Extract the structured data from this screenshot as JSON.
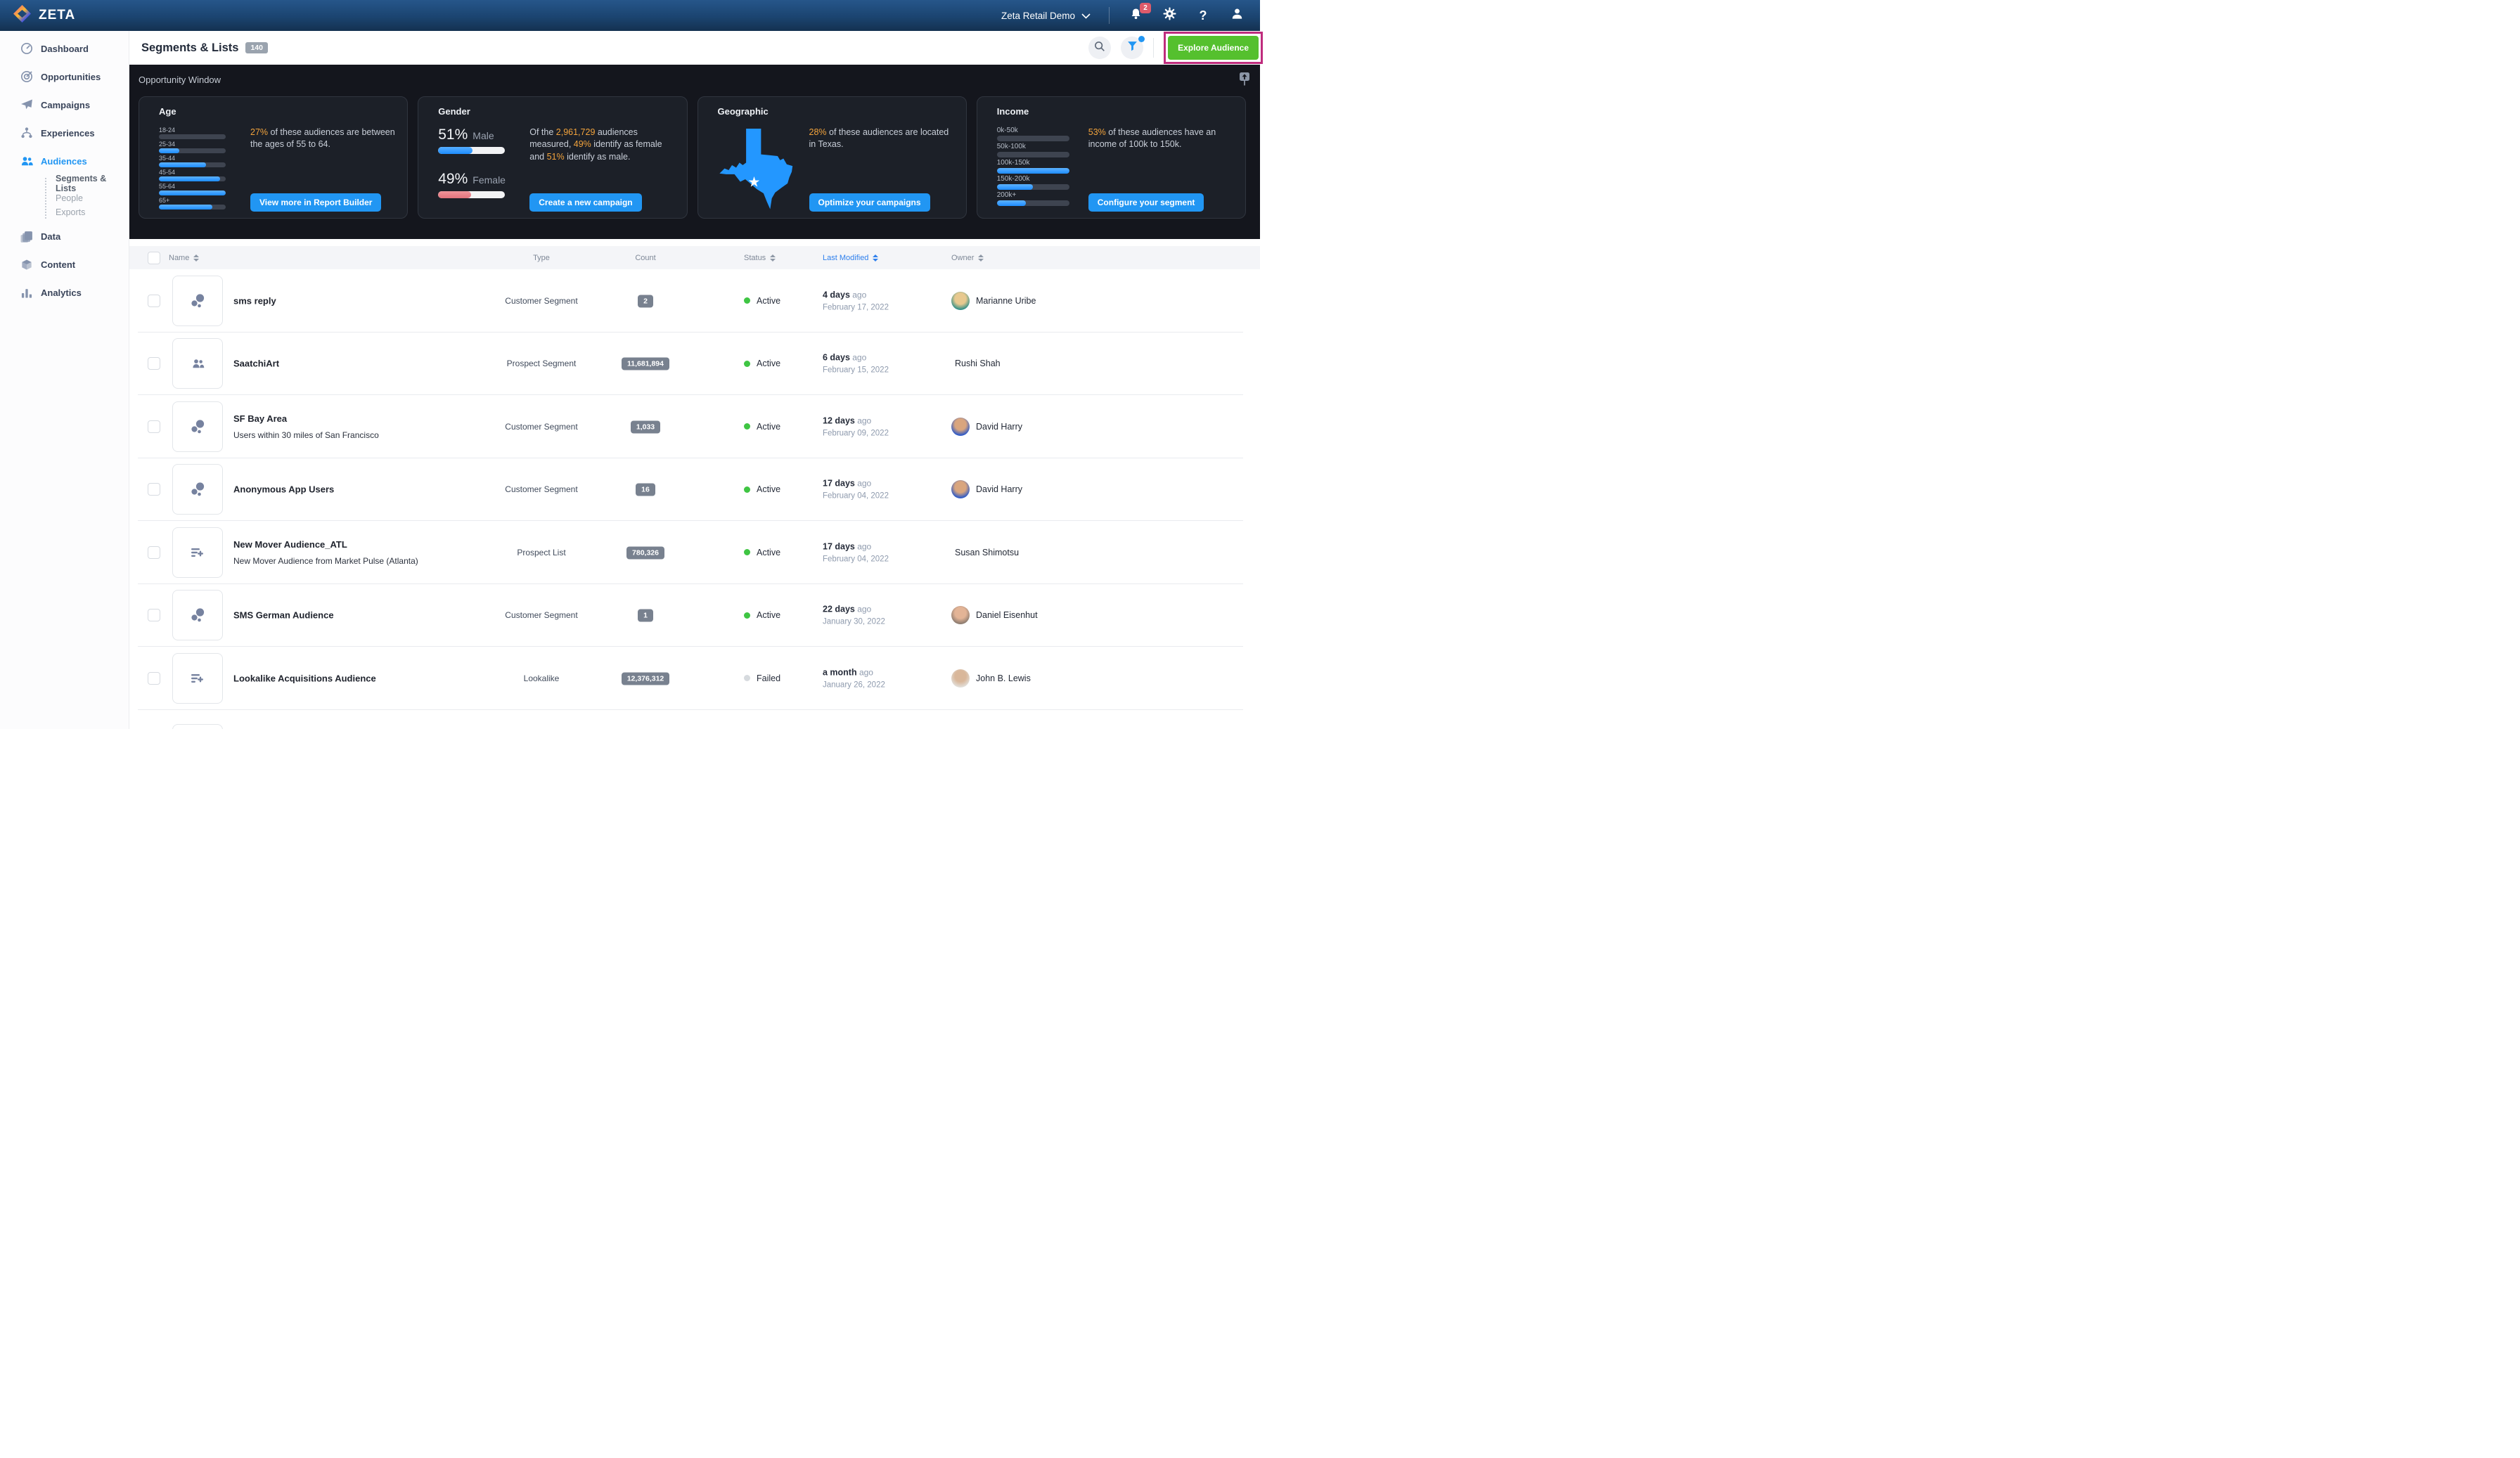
{
  "colors": {
    "accent_blue": "#2196f3",
    "orange": "#f2a33c",
    "green_button": "#55c02e",
    "annotation_magenta": "#bf2c7d",
    "status_active": "#3fc543",
    "status_failed": "#d6dade"
  },
  "topbar": {
    "brand": "ZETA",
    "account": "Zeta Retail Demo",
    "notification_count": "2"
  },
  "sidebar": {
    "items": [
      {
        "label": "Dashboard",
        "icon": "gauge"
      },
      {
        "label": "Opportunities",
        "icon": "target"
      },
      {
        "label": "Campaigns",
        "icon": "paper-plane"
      },
      {
        "label": "Experiences",
        "icon": "flow"
      },
      {
        "label": "Audiences",
        "icon": "people",
        "active": true,
        "has_subs": true
      },
      {
        "label": "Data",
        "icon": "stack"
      },
      {
        "label": "Content",
        "icon": "cube"
      },
      {
        "label": "Analytics",
        "icon": "bars"
      }
    ],
    "subs": [
      {
        "label": "Segments & Lists",
        "active": true
      },
      {
        "label": "People"
      },
      {
        "label": "Exports"
      }
    ]
  },
  "header": {
    "title": "Segments & Lists",
    "count_badge": "140",
    "explore_button": "Explore Audience"
  },
  "opportunity": {
    "section_title": "Opportunity Window",
    "age": {
      "title": "Age",
      "bars": [
        {
          "label": "18-24",
          "pct": 0
        },
        {
          "label": "25-34",
          "pct": 30
        },
        {
          "label": "35-44",
          "pct": 71
        },
        {
          "label": "45-54",
          "pct": 92
        },
        {
          "label": "55-64",
          "pct": 100
        },
        {
          "label": "65+",
          "pct": 80
        }
      ],
      "text": [
        [
          "27%",
          1
        ],
        [
          " of these audiences are between the ages of 55 to 64.",
          0
        ]
      ],
      "button": "View more in Report Builder"
    },
    "gender": {
      "title": "Gender",
      "male_pct": "51%",
      "male_label": "Male",
      "male_fill": 51,
      "female_pct": "49%",
      "female_label": "Female",
      "female_fill": 49,
      "text": [
        [
          "Of the ",
          0
        ],
        [
          "2,961,729",
          1
        ],
        [
          " audiences measured, ",
          0
        ],
        [
          "49%",
          1
        ],
        [
          " identify as female and ",
          0
        ],
        [
          "51%",
          1
        ],
        [
          " identify as male.",
          0
        ]
      ],
      "button": "Create a new campaign"
    },
    "geographic": {
      "title": "Geographic",
      "state": "Texas",
      "text": [
        [
          "28%",
          1
        ],
        [
          " of these audiences are located in Texas.",
          0
        ]
      ],
      "button": "Optimize your campaigns"
    },
    "income": {
      "title": "Income",
      "bars": [
        {
          "label": "0k-50k",
          "pct": 0
        },
        {
          "label": "50k-100k",
          "pct": 0
        },
        {
          "label": "100k-150k",
          "pct": 100
        },
        {
          "label": "150k-200k",
          "pct": 50
        },
        {
          "label": "200k+",
          "pct": 40
        }
      ],
      "text": [
        [
          "53%",
          1
        ],
        [
          " of these audiences have an income of 100k to 150k.",
          0
        ]
      ],
      "button": "Configure your segment"
    }
  },
  "table": {
    "columns": [
      {
        "label": "Name",
        "sortable": true
      },
      {
        "label": "Type"
      },
      {
        "label": "Count"
      },
      {
        "label": "Status",
        "sortable": true
      },
      {
        "label": "Last Modified",
        "sortable": true,
        "sorted": true
      },
      {
        "label": "Owner",
        "sortable": true
      }
    ],
    "rows": [
      {
        "name": "sms reply",
        "icon": "segment",
        "type": "Customer Segment",
        "count": "2",
        "status": "Active",
        "active": true,
        "rel": "4 days",
        "ago": "ago",
        "date": "February 17, 2022",
        "owner": "Marianne Uribe",
        "avatar": {
          "c1": "#e8c98f",
          "c2": "#2f8f88"
        }
      },
      {
        "name": "SaatchiArt",
        "icon": "people",
        "type": "Prospect Segment",
        "count": "11,681,894",
        "status": "Active",
        "active": true,
        "rel": "6 days",
        "ago": "ago",
        "date": "February 15, 2022",
        "owner": "Rushi Shah",
        "avatar": null
      },
      {
        "name": "SF Bay Area",
        "desc": "Users within 30 miles of San Francisco",
        "icon": "segment",
        "type": "Customer Segment",
        "count": "1,033",
        "status": "Active",
        "active": true,
        "rel": "12 days",
        "ago": "ago",
        "date": "February 09, 2022",
        "owner": "David Harry",
        "avatar": {
          "c1": "#d9a57e",
          "c2": "#2857c9"
        }
      },
      {
        "name": "Anonymous App Users",
        "icon": "segment",
        "type": "Customer Segment",
        "count": "16",
        "status": "Active",
        "active": true,
        "rel": "17 days",
        "ago": "ago",
        "date": "February 04, 2022",
        "owner": "David Harry",
        "avatar": {
          "c1": "#d9a57e",
          "c2": "#2857c9"
        }
      },
      {
        "name": "New Mover Audience_ATL",
        "desc": "New Mover Audience from Market Pulse (Atlanta)",
        "icon": "list",
        "type": "Prospect List",
        "count": "780,326",
        "status": "Active",
        "active": true,
        "rel": "17 days",
        "ago": "ago",
        "date": "February 04, 2022",
        "owner": "Susan  Shimotsu",
        "avatar": null
      },
      {
        "name": "SMS German Audience",
        "icon": "segment",
        "type": "Customer Segment",
        "count": "1",
        "status": "Active",
        "active": true,
        "rel": "22 days",
        "ago": "ago",
        "date": "January 30, 2022",
        "owner": "Daniel Eisenhut",
        "avatar": {
          "c1": "#e3b496",
          "c2": "#8a7a6f"
        }
      },
      {
        "name": "Lookalike Acquisitions Audience",
        "icon": "list",
        "type": "Lookalike",
        "count": "12,376,312",
        "status": "Failed",
        "active": false,
        "rel": "a month",
        "ago": "ago",
        "date": "January 26, 2022",
        "owner": "John B. Lewis",
        "avatar": {
          "c1": "#d9b79a",
          "c2": "#e2dfda"
        }
      }
    ]
  }
}
